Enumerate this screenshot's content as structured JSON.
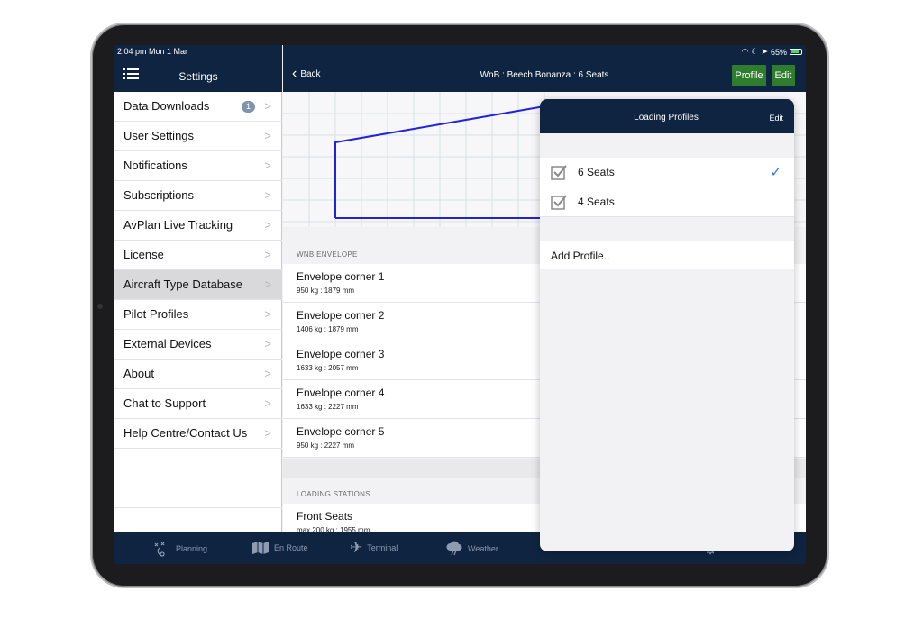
{
  "status_bar": {
    "time": "2:04 pm  Mon 1 Mar",
    "battery": "65%"
  },
  "sidebar": {
    "title": "Settings",
    "items": [
      {
        "label": "Data Downloads",
        "badge": "1"
      },
      {
        "label": "User Settings"
      },
      {
        "label": "Notifications"
      },
      {
        "label": "Subscriptions"
      },
      {
        "label": "AvPlan Live Tracking"
      },
      {
        "label": "License"
      },
      {
        "label": "Aircraft Type Database",
        "selected": true
      },
      {
        "label": "Pilot Profiles"
      },
      {
        "label": "External Devices"
      },
      {
        "label": "About"
      },
      {
        "label": "Chat to Support"
      },
      {
        "label": "Help Centre/Contact Us"
      }
    ]
  },
  "nav": {
    "back_label": "Back",
    "title": "WnB : Beech Bonanza : 6 Seats",
    "profile_label": "Profile",
    "edit_label": "Edit"
  },
  "envelope": {
    "section_label": "WNB ENVELOPE",
    "corners": [
      {
        "title": "Envelope corner 1",
        "value": "950 kg : 1879 mm"
      },
      {
        "title": "Envelope corner 2",
        "value": "1406 kg : 1879 mm"
      },
      {
        "title": "Envelope corner 3",
        "value": "1633 kg : 2057 mm"
      },
      {
        "title": "Envelope corner 4",
        "value": "1633 kg : 2227 mm"
      },
      {
        "title": "Envelope corner 5",
        "value": "950 kg : 2227 mm"
      }
    ]
  },
  "stations": {
    "section_label": "LOADING STATIONS",
    "items": [
      {
        "title": "Front Seats",
        "value": "max 200 kg : 1955 mm"
      }
    ]
  },
  "tabbar": {
    "items": [
      {
        "label": "Planning",
        "icon": "planning-icon"
      },
      {
        "label": "En Route",
        "icon": "map-icon"
      },
      {
        "label": "Terminal",
        "icon": "airplane-icon"
      },
      {
        "label": "Weather",
        "icon": "weather-icon"
      }
    ]
  },
  "popover": {
    "title": "Loading Profiles",
    "edit_label": "Edit",
    "profiles": [
      {
        "label": "6 Seats",
        "selected": true
      },
      {
        "label": "4 Seats",
        "selected": false
      }
    ],
    "add_label": "Add Profile.."
  },
  "colors": {
    "nav_bg": "#0f2440",
    "accent_green": "#2e7d2e",
    "check_blue": "#2f7ae5",
    "envelope_line": "#2222dd"
  }
}
